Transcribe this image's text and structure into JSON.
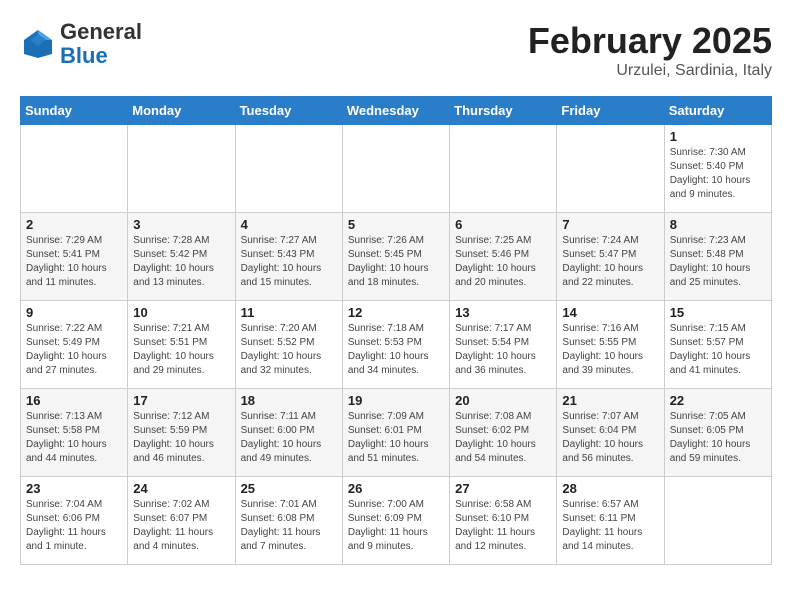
{
  "logo": {
    "line1": "General",
    "line2": "Blue"
  },
  "title": "February 2025",
  "subtitle": "Urzulei, Sardinia, Italy",
  "days_of_week": [
    "Sunday",
    "Monday",
    "Tuesday",
    "Wednesday",
    "Thursday",
    "Friday",
    "Saturday"
  ],
  "weeks": [
    [
      {
        "day": "",
        "info": ""
      },
      {
        "day": "",
        "info": ""
      },
      {
        "day": "",
        "info": ""
      },
      {
        "day": "",
        "info": ""
      },
      {
        "day": "",
        "info": ""
      },
      {
        "day": "",
        "info": ""
      },
      {
        "day": "1",
        "info": "Sunrise: 7:30 AM\nSunset: 5:40 PM\nDaylight: 10 hours\nand 9 minutes."
      }
    ],
    [
      {
        "day": "2",
        "info": "Sunrise: 7:29 AM\nSunset: 5:41 PM\nDaylight: 10 hours\nand 11 minutes."
      },
      {
        "day": "3",
        "info": "Sunrise: 7:28 AM\nSunset: 5:42 PM\nDaylight: 10 hours\nand 13 minutes."
      },
      {
        "day": "4",
        "info": "Sunrise: 7:27 AM\nSunset: 5:43 PM\nDaylight: 10 hours\nand 15 minutes."
      },
      {
        "day": "5",
        "info": "Sunrise: 7:26 AM\nSunset: 5:45 PM\nDaylight: 10 hours\nand 18 minutes."
      },
      {
        "day": "6",
        "info": "Sunrise: 7:25 AM\nSunset: 5:46 PM\nDaylight: 10 hours\nand 20 minutes."
      },
      {
        "day": "7",
        "info": "Sunrise: 7:24 AM\nSunset: 5:47 PM\nDaylight: 10 hours\nand 22 minutes."
      },
      {
        "day": "8",
        "info": "Sunrise: 7:23 AM\nSunset: 5:48 PM\nDaylight: 10 hours\nand 25 minutes."
      }
    ],
    [
      {
        "day": "9",
        "info": "Sunrise: 7:22 AM\nSunset: 5:49 PM\nDaylight: 10 hours\nand 27 minutes."
      },
      {
        "day": "10",
        "info": "Sunrise: 7:21 AM\nSunset: 5:51 PM\nDaylight: 10 hours\nand 29 minutes."
      },
      {
        "day": "11",
        "info": "Sunrise: 7:20 AM\nSunset: 5:52 PM\nDaylight: 10 hours\nand 32 minutes."
      },
      {
        "day": "12",
        "info": "Sunrise: 7:18 AM\nSunset: 5:53 PM\nDaylight: 10 hours\nand 34 minutes."
      },
      {
        "day": "13",
        "info": "Sunrise: 7:17 AM\nSunset: 5:54 PM\nDaylight: 10 hours\nand 36 minutes."
      },
      {
        "day": "14",
        "info": "Sunrise: 7:16 AM\nSunset: 5:55 PM\nDaylight: 10 hours\nand 39 minutes."
      },
      {
        "day": "15",
        "info": "Sunrise: 7:15 AM\nSunset: 5:57 PM\nDaylight: 10 hours\nand 41 minutes."
      }
    ],
    [
      {
        "day": "16",
        "info": "Sunrise: 7:13 AM\nSunset: 5:58 PM\nDaylight: 10 hours\nand 44 minutes."
      },
      {
        "day": "17",
        "info": "Sunrise: 7:12 AM\nSunset: 5:59 PM\nDaylight: 10 hours\nand 46 minutes."
      },
      {
        "day": "18",
        "info": "Sunrise: 7:11 AM\nSunset: 6:00 PM\nDaylight: 10 hours\nand 49 minutes."
      },
      {
        "day": "19",
        "info": "Sunrise: 7:09 AM\nSunset: 6:01 PM\nDaylight: 10 hours\nand 51 minutes."
      },
      {
        "day": "20",
        "info": "Sunrise: 7:08 AM\nSunset: 6:02 PM\nDaylight: 10 hours\nand 54 minutes."
      },
      {
        "day": "21",
        "info": "Sunrise: 7:07 AM\nSunset: 6:04 PM\nDaylight: 10 hours\nand 56 minutes."
      },
      {
        "day": "22",
        "info": "Sunrise: 7:05 AM\nSunset: 6:05 PM\nDaylight: 10 hours\nand 59 minutes."
      }
    ],
    [
      {
        "day": "23",
        "info": "Sunrise: 7:04 AM\nSunset: 6:06 PM\nDaylight: 11 hours\nand 1 minute."
      },
      {
        "day": "24",
        "info": "Sunrise: 7:02 AM\nSunset: 6:07 PM\nDaylight: 11 hours\nand 4 minutes."
      },
      {
        "day": "25",
        "info": "Sunrise: 7:01 AM\nSunset: 6:08 PM\nDaylight: 11 hours\nand 7 minutes."
      },
      {
        "day": "26",
        "info": "Sunrise: 7:00 AM\nSunset: 6:09 PM\nDaylight: 11 hours\nand 9 minutes."
      },
      {
        "day": "27",
        "info": "Sunrise: 6:58 AM\nSunset: 6:10 PM\nDaylight: 11 hours\nand 12 minutes."
      },
      {
        "day": "28",
        "info": "Sunrise: 6:57 AM\nSunset: 6:11 PM\nDaylight: 11 hours\nand 14 minutes."
      },
      {
        "day": "",
        "info": ""
      }
    ]
  ]
}
